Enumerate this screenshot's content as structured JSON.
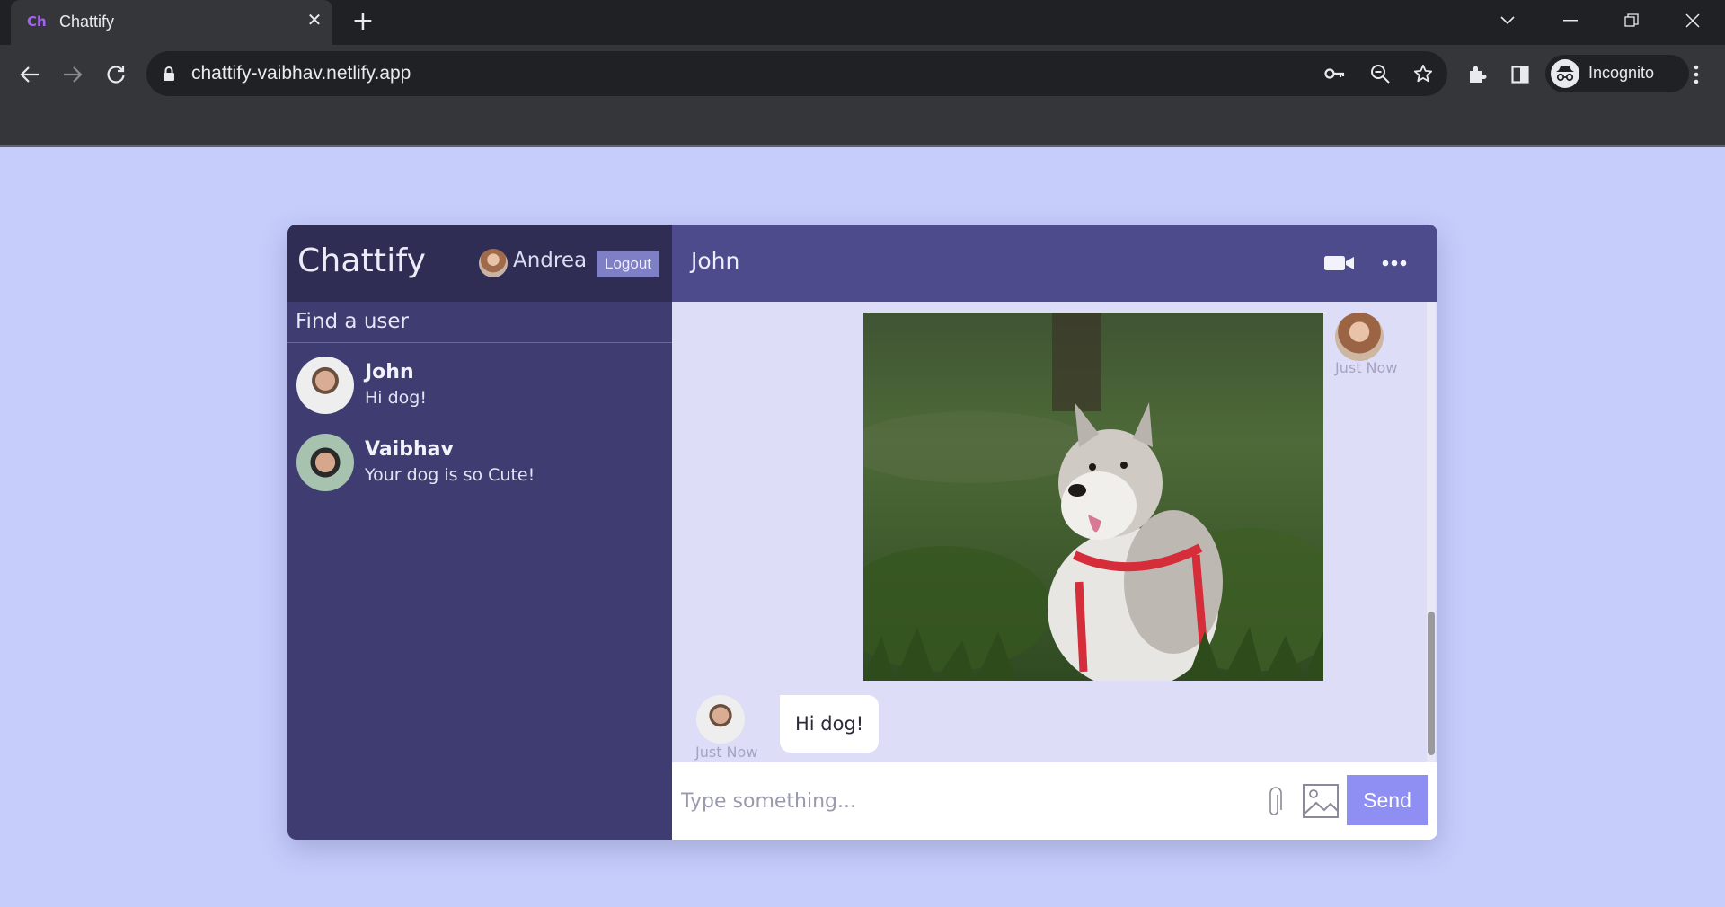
{
  "browser": {
    "tab_favicon": "Ch",
    "tab_title": "Chattify",
    "url": "chattify-vaibhav.netlify.app",
    "profile_label": "Incognito"
  },
  "app": {
    "logo": "Chattify",
    "current_user": "Andrea",
    "logout_label": "Logout",
    "search_placeholder": "Find a user",
    "chats": [
      {
        "name": "John",
        "last_message": "Hi dog!"
      },
      {
        "name": "Vaibhav",
        "last_message": "Your dog is so Cute!"
      }
    ],
    "chat_header": {
      "title": "John"
    },
    "messages": [
      {
        "sender": "owner",
        "type": "image",
        "image_description": "husky-dog-photo",
        "time": "Just Now"
      },
      {
        "sender": "John",
        "type": "text",
        "text": "Hi dog!",
        "time": "Just Now"
      }
    ],
    "input": {
      "placeholder": "Type something...",
      "send_label": "Send"
    }
  },
  "colors": {
    "page_bg": "#c6cdfb",
    "sidebar_bg": "#3e3c70",
    "sidebar_nav_bg": "#2f2d53",
    "chat_header_bg": "#4d4b8c",
    "messages_bg": "#ddddf7",
    "send_button": "#8f8ff3",
    "logout_button": "#7f7fc6"
  }
}
